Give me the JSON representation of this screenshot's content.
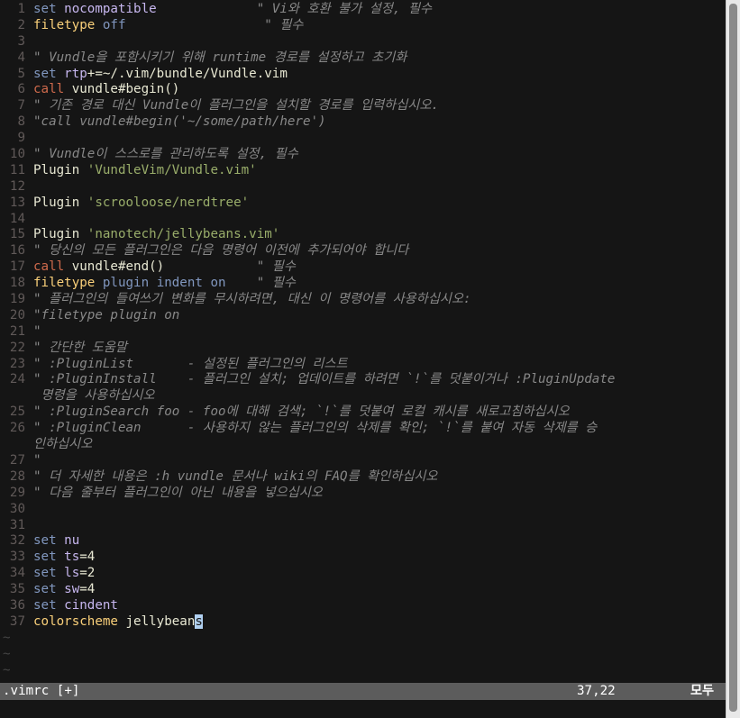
{
  "buffer": {
    "lines": [
      {
        "n": "1",
        "segs": [
          [
            "cmd",
            "set"
          ],
          [
            "plain",
            " "
          ],
          [
            "opt",
            "nocompatible"
          ],
          [
            "plain",
            "             "
          ],
          [
            "com",
            "\" Vi와 호환 불가 설정, 필수"
          ]
        ]
      },
      {
        "n": "2",
        "segs": [
          [
            "yel",
            "filetype"
          ],
          [
            "plain",
            " "
          ],
          [
            "k",
            "off"
          ],
          [
            "plain",
            "                  "
          ],
          [
            "com",
            "\" 필수"
          ]
        ]
      },
      {
        "n": "3",
        "segs": []
      },
      {
        "n": "4",
        "segs": [
          [
            "com",
            "\" Vundle을 포함시키기 위해 runtime 경로를 설정하고 초기화"
          ]
        ]
      },
      {
        "n": "5",
        "segs": [
          [
            "cmd",
            "set"
          ],
          [
            "plain",
            " "
          ],
          [
            "opt",
            "rtp"
          ],
          [
            "plain",
            "+=~/.vim/bundle/Vundle.vim"
          ]
        ]
      },
      {
        "n": "6",
        "segs": [
          [
            "sp",
            "call"
          ],
          [
            "plain",
            " vundle#begin()"
          ]
        ]
      },
      {
        "n": "7",
        "segs": [
          [
            "com",
            "\" 기존 경로 대신 Vundle이 플러그인을 설치할 경로를 입력하십시오."
          ]
        ]
      },
      {
        "n": "8",
        "segs": [
          [
            "com",
            "\"call vundle#begin('~/some/path/here')"
          ]
        ]
      },
      {
        "n": "9",
        "segs": []
      },
      {
        "n": "10",
        "segs": [
          [
            "com",
            "\" Vundle이 스스로를 관리하도록 설정, 필수"
          ]
        ]
      },
      {
        "n": "11",
        "segs": [
          [
            "plain",
            "Plugin "
          ],
          [
            "str",
            "'VundleVim/Vundle.vim'"
          ]
        ]
      },
      {
        "n": "12",
        "segs": []
      },
      {
        "n": "13",
        "segs": [
          [
            "plain",
            "Plugin "
          ],
          [
            "str",
            "'scrooloose/nerdtree'"
          ]
        ]
      },
      {
        "n": "14",
        "segs": []
      },
      {
        "n": "15",
        "segs": [
          [
            "plain",
            "Plugin "
          ],
          [
            "str",
            "'nanotech/jellybeans.vim'"
          ]
        ]
      },
      {
        "n": "16",
        "segs": [
          [
            "com",
            "\" 당신의 모든 플러그인은 다음 명령어 이전에 추가되어야 합니다"
          ]
        ]
      },
      {
        "n": "17",
        "segs": [
          [
            "sp",
            "call"
          ],
          [
            "plain",
            " vundle#end()"
          ],
          [
            "plain",
            "            "
          ],
          [
            "com",
            "\" 필수"
          ]
        ]
      },
      {
        "n": "18",
        "segs": [
          [
            "yel",
            "filetype"
          ],
          [
            "plain",
            " "
          ],
          [
            "k",
            "plugin"
          ],
          [
            "plain",
            " "
          ],
          [
            "k",
            "indent"
          ],
          [
            "plain",
            " "
          ],
          [
            "k",
            "on"
          ],
          [
            "plain",
            "    "
          ],
          [
            "com",
            "\" 필수"
          ]
        ]
      },
      {
        "n": "19",
        "segs": [
          [
            "com",
            "\" 플러그인의 들여쓰기 변화를 무시하려면, 대신 이 명령어를 사용하십시오:"
          ]
        ]
      },
      {
        "n": "20",
        "segs": [
          [
            "com",
            "\"filetype plugin on"
          ]
        ]
      },
      {
        "n": "21",
        "segs": [
          [
            "com",
            "\""
          ]
        ]
      },
      {
        "n": "22",
        "segs": [
          [
            "com",
            "\" 간단한 도움말"
          ]
        ]
      },
      {
        "n": "23",
        "segs": [
          [
            "com",
            "\" :PluginList       - 설정된 플러그인의 리스트"
          ]
        ]
      },
      {
        "n": "24",
        "segs": [
          [
            "com",
            "\" :PluginInstall    - 플러그인 설치; 업데이트를 하려면 `!`를 덧붙이거나 :PluginUpdate"
          ]
        ]
      },
      {
        "n": "",
        "segs": [
          [
            "com",
            " 명령을 사용하십시오"
          ]
        ]
      },
      {
        "n": "25",
        "segs": [
          [
            "com",
            "\" :PluginSearch foo - foo에 대해 검색; `!`를 덧붙여 로컬 캐시를 새로고침하십시오"
          ]
        ]
      },
      {
        "n": "26",
        "segs": [
          [
            "com",
            "\" :PluginClean      - 사용하지 않는 플러그인의 삭제를 확인; `!`를 붙여 자동 삭제를 승"
          ]
        ]
      },
      {
        "n": "",
        "segs": [
          [
            "com",
            "인하십시오"
          ]
        ]
      },
      {
        "n": "27",
        "segs": [
          [
            "com",
            "\""
          ]
        ]
      },
      {
        "n": "28",
        "segs": [
          [
            "com",
            "\" 더 자세한 내용은 :h vundle 문서나 wiki의 FAQ를 확인하십시오"
          ]
        ]
      },
      {
        "n": "29",
        "segs": [
          [
            "com",
            "\" 다음 줄부터 플러그인이 아닌 내용을 넣으십시오"
          ]
        ]
      },
      {
        "n": "30",
        "segs": []
      },
      {
        "n": "31",
        "segs": []
      },
      {
        "n": "32",
        "segs": [
          [
            "cmd",
            "set"
          ],
          [
            "plain",
            " "
          ],
          [
            "opt",
            "nu"
          ]
        ]
      },
      {
        "n": "33",
        "segs": [
          [
            "cmd",
            "set"
          ],
          [
            "plain",
            " "
          ],
          [
            "opt",
            "ts"
          ],
          [
            "plain",
            "=4"
          ]
        ]
      },
      {
        "n": "34",
        "segs": [
          [
            "cmd",
            "set"
          ],
          [
            "plain",
            " "
          ],
          [
            "opt",
            "ls"
          ],
          [
            "plain",
            "=2"
          ]
        ]
      },
      {
        "n": "35",
        "segs": [
          [
            "cmd",
            "set"
          ],
          [
            "plain",
            " "
          ],
          [
            "opt",
            "sw"
          ],
          [
            "plain",
            "=4"
          ]
        ]
      },
      {
        "n": "36",
        "segs": [
          [
            "cmd",
            "set"
          ],
          [
            "plain",
            " "
          ],
          [
            "opt",
            "cindent"
          ]
        ]
      },
      {
        "n": "37",
        "segs": [
          [
            "yel",
            "colorscheme"
          ],
          [
            "plain",
            " jellybean"
          ],
          [
            "cursor",
            "s"
          ]
        ]
      }
    ],
    "tildes": [
      "~",
      "~",
      "~"
    ]
  },
  "status": {
    "file": ".vimrc [+]",
    "position": "37,22",
    "percent": "모두"
  },
  "colors": {
    "background": "#151515",
    "statusline": "#5c5c5c",
    "cursor": "#b0d0f0"
  }
}
